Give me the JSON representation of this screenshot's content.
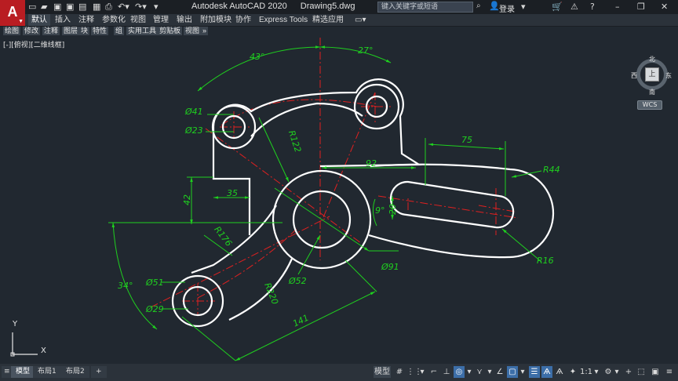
{
  "app": {
    "logo_letter": "A",
    "title": "Autodesk AutoCAD 2020",
    "document": "Drawing5.dwg"
  },
  "search": {
    "placeholder": "键入关键字或短语"
  },
  "user": {
    "login_label": "登录"
  },
  "ribbon_tabs": [
    "默认",
    "插入",
    "注释",
    "参数化",
    "视图",
    "管理",
    "输出",
    "附加模块",
    "协作",
    "Express Tools",
    "精选应用"
  ],
  "toolbar_items": [
    "绘图",
    "修改",
    "注释",
    "图层",
    "块",
    "特性",
    "组",
    "实用工具",
    "剪贴板",
    "视图"
  ],
  "viewport_label": "[-][俯视][二维线框]",
  "viewcube": {
    "north": "北",
    "south": "南",
    "east": "东",
    "west": "西",
    "top": "上",
    "wcs": "WCS"
  },
  "ucs": {
    "x": "X",
    "y": "Y"
  },
  "layout_tabs": [
    "模型",
    "布局1",
    "布局2"
  ],
  "status": {
    "model": "模型",
    "scale": "1:1"
  },
  "dimensions": {
    "angle_43": "43°",
    "angle_27": "27°",
    "dia_41": "Ø41",
    "dia_23": "Ø23",
    "r_122": "R122",
    "len_75": "75",
    "len_92": "92",
    "r_44": "R44",
    "len_42": "42",
    "len_35": "35",
    "angle_9": "9°",
    "len_20": "20",
    "r_176": "R176",
    "r_16": "R16",
    "dia_91": "Ø91",
    "angle_34": "34°",
    "dia_51": "Ø51",
    "dia_52": "Ø52",
    "r_220": "R220",
    "dia_29": "Ø29",
    "len_141": "141"
  },
  "colors": {
    "background": "#212830",
    "geometry": "#ffffff",
    "dimension": "#1fd01f",
    "centerline": "#e02020",
    "accent": "#b91d22"
  }
}
